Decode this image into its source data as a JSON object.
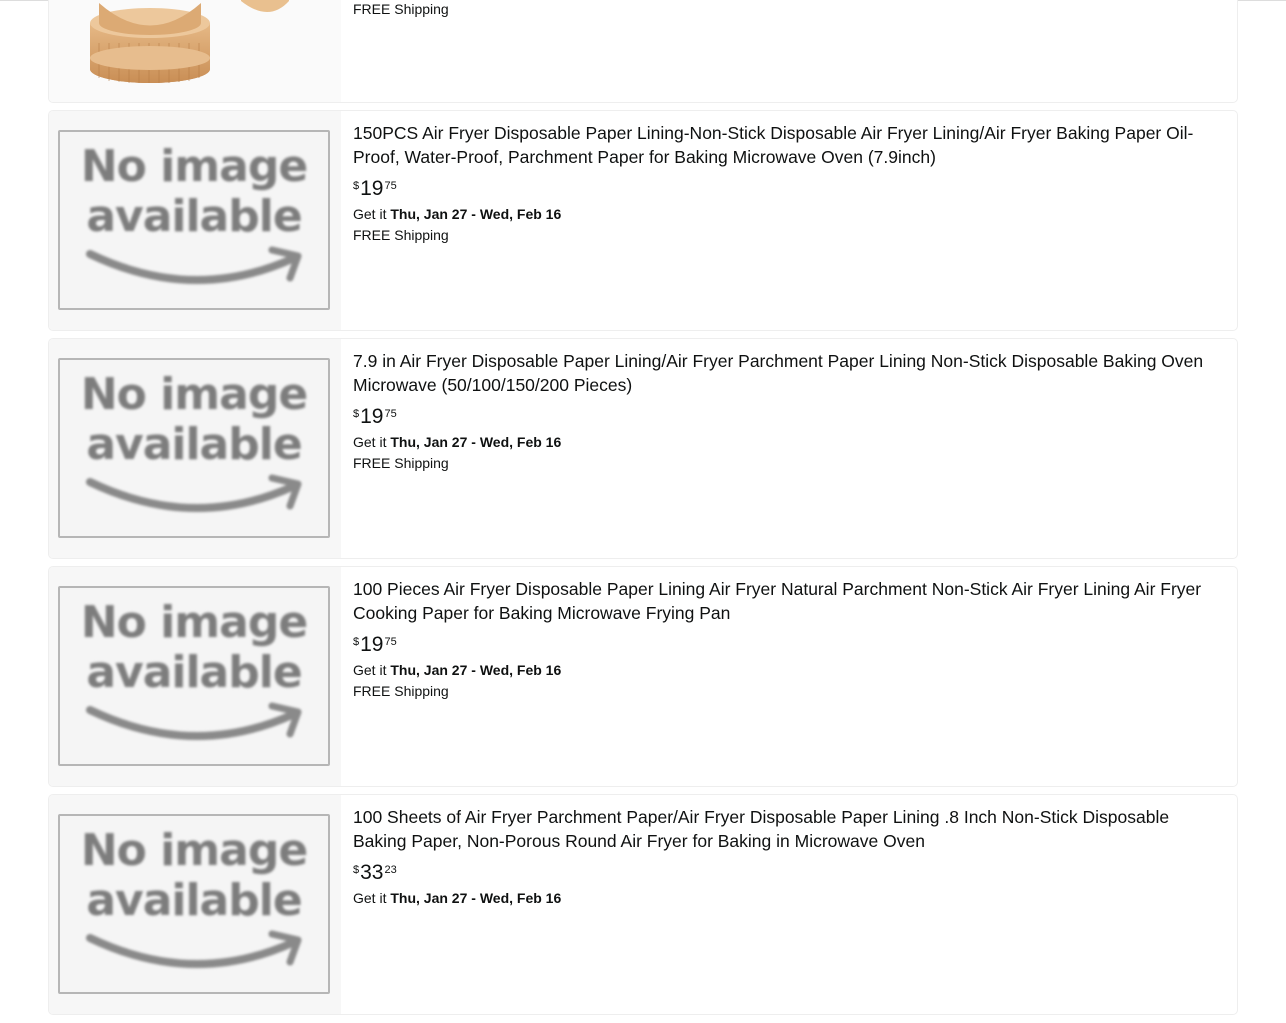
{
  "products": [
    {
      "title": "",
      "price_symbol": "",
      "price_whole": "",
      "price_fraction": "",
      "delivery_prefix": "",
      "delivery_dates": "",
      "shipping": "FREE Shipping",
      "image": "product-photo"
    },
    {
      "title": "150PCS Air Fryer Disposable Paper Lining-Non-Stick Disposable Air Fryer Lining/Air Fryer Baking Paper Oil-Proof, Water-Proof, Parchment Paper for Baking Microwave Oven (7.9inch)",
      "price_symbol": "$",
      "price_whole": "19",
      "price_fraction": "75",
      "delivery_prefix": "Get it ",
      "delivery_dates": "Thu, Jan 27 - Wed, Feb 16",
      "shipping": "FREE Shipping",
      "image": "no-image-placeholder"
    },
    {
      "title": "7.9 in Air Fryer Disposable Paper Lining/Air Fryer Parchment Paper Lining Non-Stick Disposable Baking Oven Microwave (50/100/150/200 Pieces)",
      "price_symbol": "$",
      "price_whole": "19",
      "price_fraction": "75",
      "delivery_prefix": "Get it ",
      "delivery_dates": "Thu, Jan 27 - Wed, Feb 16",
      "shipping": "FREE Shipping",
      "image": "no-image-placeholder"
    },
    {
      "title": "100 Pieces Air Fryer Disposable Paper Lining Air Fryer Natural Parchment Non-Stick Air Fryer Lining Air Fryer Cooking Paper for Baking Microwave Frying Pan",
      "price_symbol": "$",
      "price_whole": "19",
      "price_fraction": "75",
      "delivery_prefix": "Get it ",
      "delivery_dates": "Thu, Jan 27 - Wed, Feb 16",
      "shipping": "FREE Shipping",
      "image": "no-image-placeholder"
    },
    {
      "title": "100 Sheets of Air Fryer Parchment Paper/Air Fryer Disposable Paper Lining .8 Inch Non-Stick Disposable Baking Paper, Non-Porous Round Air Fryer for Baking in Microwave Oven",
      "price_symbol": "$",
      "price_whole": "33",
      "price_fraction": "23",
      "delivery_prefix": "Get it ",
      "delivery_dates": "Thu, Jan 27 - Wed, Feb 16",
      "shipping": "",
      "image": "no-image-placeholder"
    }
  ],
  "no_image_text": "No image\navailable",
  "colors": {
    "text": "#0f1111",
    "placeholder_gray": "#7d7d7d",
    "card_thumb_bg": "#f7f7f7",
    "parchment": "#d9a871"
  }
}
